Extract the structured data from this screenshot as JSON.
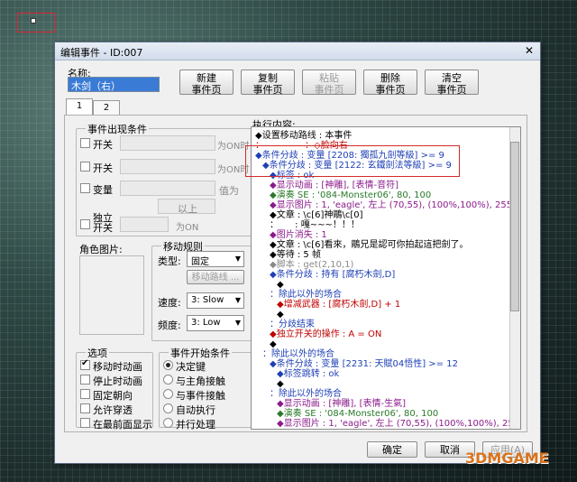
{
  "window": {
    "title": "编辑事件 - ID:007",
    "close": "✕"
  },
  "name_label": "名称:",
  "name_value": "木剑（右）",
  "buttons": {
    "new_page": [
      "新建",
      "事件页"
    ],
    "copy_page": [
      "复制",
      "事件页"
    ],
    "paste_page": [
      "粘贴",
      "事件页"
    ],
    "delete_page": [
      "删除",
      "事件页"
    ],
    "clear_page": [
      "清空",
      "事件页"
    ]
  },
  "tabs": [
    "1",
    "2"
  ],
  "conditions": {
    "title": "事件出现条件",
    "switch1": "开关",
    "switch2": "开关",
    "variable": "变量",
    "self_switch": [
      "独立",
      "开关"
    ],
    "is_on1": "为ON时",
    "is_on2": "为ON时",
    "value_label": "值为",
    "above": "以上",
    "is_on3": "为ON"
  },
  "graphic_label": "角色图片:",
  "movement": {
    "title": "移动规则",
    "type_label": "类型:",
    "type_value": "固定",
    "route_button": "移动路线 ...",
    "speed_label": "速度:",
    "speed_value": "3: Slow",
    "freq_label": "频度:",
    "freq_value": "3: Low"
  },
  "options": {
    "title": "选项",
    "items": [
      {
        "label": "移动时动画",
        "checked": true
      },
      {
        "label": "停止时动画",
        "checked": false
      },
      {
        "label": "固定朝向",
        "checked": false
      },
      {
        "label": "允许穿透",
        "checked": false
      },
      {
        "label": "在最前面显示",
        "checked": false
      }
    ]
  },
  "trigger": {
    "title": "事件开始条件",
    "items": [
      {
        "label": "决定键",
        "checked": true
      },
      {
        "label": "与主角接触",
        "checked": false
      },
      {
        "label": "与事件接触",
        "checked": false
      },
      {
        "label": "自动执行",
        "checked": false
      },
      {
        "label": "并行处理",
        "checked": false
      }
    ]
  },
  "contents_label": "执行内容:",
  "contents": [
    {
      "text": "◆设置移动路线 : 本事件",
      "color": "#000000",
      "indent": 0
    },
    {
      "text": "：　　　　　：◇脸向右",
      "color": "#c00000",
      "indent": 0
    },
    {
      "text": "◆条件分歧 : 变量 [2208: 獨孤九劍等級] >= 9",
      "color": "#1d3fb5",
      "indent": 0
    },
    {
      "text": "◆条件分歧 : 变量 [2122: 玄鐵劍法等級] >= 9",
      "color": "#1d3fb5",
      "indent": 1
    },
    {
      "text": "◆标签 : ok",
      "color": "#1d3fb5",
      "indent": 2
    },
    {
      "text": "◆显示动画 : [神雕], [表情-音符]",
      "color": "#8b1a8b",
      "indent": 2
    },
    {
      "text": "◆演奏 SE : '084-Monster06', 80, 100",
      "color": "#2a7a2a",
      "indent": 2
    },
    {
      "text": "◆显示图片 : 1, 'eagle', 左上 (70,55), (100%,100%), 255,",
      "color": "#8b1a8b",
      "indent": 2
    },
    {
      "text": "◆文章 : \\c[6]神鵰\\c[0]",
      "color": "#000000",
      "indent": 2
    },
    {
      "text": "：　　 : 嘎~~~！！！",
      "color": "#000000",
      "indent": 2
    },
    {
      "text": "◆图片消失 : 1",
      "color": "#8b1a8b",
      "indent": 2
    },
    {
      "text": "◆文章 : \\c[6]看來，鵰兄是認可你拍起這把劍了。",
      "color": "#000000",
      "indent": 2
    },
    {
      "text": "◆等待 : 5 帧",
      "color": "#000000",
      "indent": 2
    },
    {
      "text": "◆脚本 : get(2,10,1)",
      "color": "#8a8a8a",
      "indent": 2
    },
    {
      "text": "◆条件分歧 : 持有 [腐朽木劍,D]",
      "color": "#1d3fb5",
      "indent": 2
    },
    {
      "text": "◆",
      "color": "#000000",
      "indent": 3
    },
    {
      "text": "：除此以外的场合",
      "color": "#1d3fb5",
      "indent": 2
    },
    {
      "text": "◆增减武器 : [腐朽木劍,D] + 1",
      "color": "#c00000",
      "indent": 3
    },
    {
      "text": "◆",
      "color": "#000000",
      "indent": 3
    },
    {
      "text": "：分歧结束",
      "color": "#1d3fb5",
      "indent": 2
    },
    {
      "text": "◆独立开关的操作 : A = ON",
      "color": "#c00000",
      "indent": 2
    },
    {
      "text": "◆",
      "color": "#000000",
      "indent": 2
    },
    {
      "text": "：除此以外的场合",
      "color": "#1d3fb5",
      "indent": 1
    },
    {
      "text": "◆条件分歧 : 变量 [2231: 天賦04悟性] >= 12",
      "color": "#1d3fb5",
      "indent": 2
    },
    {
      "text": "◆标签跳转 : ok",
      "color": "#1d3fb5",
      "indent": 3
    },
    {
      "text": "◆",
      "color": "#000000",
      "indent": 3
    },
    {
      "text": "：除此以外的场合",
      "color": "#1d3fb5",
      "indent": 2
    },
    {
      "text": "◆显示动画 : [神雕], [表情-生氣]",
      "color": "#8b1a8b",
      "indent": 3
    },
    {
      "text": "◆演奏 SE : '084-Monster06', 80, 100",
      "color": "#2a7a2a",
      "indent": 3
    },
    {
      "text": "◆显示图片 : 1, 'eagle', 左上 (70,55), (100%,100%), 25",
      "color": "#8b1a8b",
      "indent": 3
    }
  ],
  "footer": {
    "ok": "确定",
    "cancel": "取消",
    "apply": "应用(A)"
  },
  "watermark": "3DMGAME"
}
